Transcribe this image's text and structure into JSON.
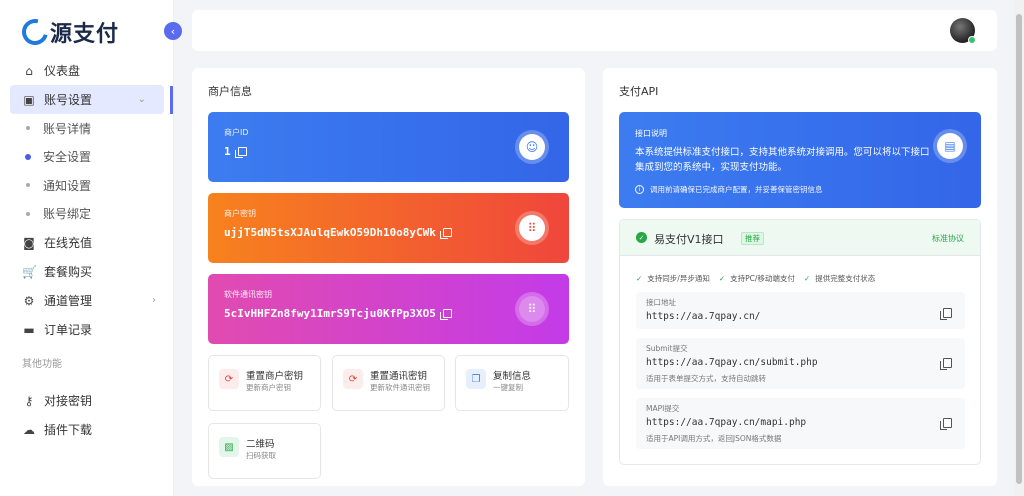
{
  "brand": {
    "name": "源支付"
  },
  "sidebar": {
    "items": [
      {
        "icon": "home-icon",
        "glyph": "⌂",
        "label": "仪表盘"
      },
      {
        "icon": "id-card-icon",
        "glyph": "▣",
        "label": "账号设置"
      },
      {
        "icon": "recharge-icon",
        "glyph": "◙",
        "label": "在线充值"
      },
      {
        "icon": "cart-icon",
        "glyph": "🛒",
        "label": "套餐购买"
      },
      {
        "icon": "gear-icon",
        "glyph": "⚙",
        "label": "通道管理"
      },
      {
        "icon": "wallet-icon",
        "glyph": "▬",
        "label": "订单记录"
      }
    ],
    "sub_items": [
      "账号详情",
      "安全设置",
      "通知设置",
      "账号绑定"
    ],
    "section_label": "其他功能",
    "other_items": [
      {
        "icon": "key-icon",
        "glyph": "⚷",
        "label": "对接密钥"
      },
      {
        "icon": "cloud-download-icon",
        "glyph": "☁",
        "label": "插件下载"
      }
    ]
  },
  "merchant": {
    "title": "商户信息",
    "cards": [
      {
        "label": "商户ID",
        "value": "1"
      },
      {
        "label": "商户密钥",
        "value": "ujjT5dN5tsXJAulqEwkO59Dh10o8yCWk"
      },
      {
        "label": "软件通讯密钥",
        "value": "5cIvHHFZn8fwy1ImrS9Tcju0KfPp3XO5"
      }
    ],
    "actions": [
      {
        "title": "重置商户密钥",
        "sub": "更新商户密钥"
      },
      {
        "title": "重置通讯密钥",
        "sub": "更新软件通讯密钥"
      },
      {
        "title": "复制信息",
        "sub": "一键复制"
      },
      {
        "title": "二维码",
        "sub": "扫码获取"
      }
    ]
  },
  "api": {
    "title": "支付API",
    "desc_title": "接口说明",
    "desc_body": "本系统提供标准支付接口，支持其他系统对接调用。您可以将以下接口集成到您的系统中，实现支付功能。",
    "desc_note": "调用前请确保已完成商户配置，并妥善保管密钥信息",
    "iface_name": "易支付V1接口",
    "iface_tag": "推荐",
    "iface_protocol": "标准协议",
    "features": [
      "支持同步/异步通知",
      "支持PC/移动端支付",
      "提供完整支付状态"
    ],
    "endpoints": [
      {
        "name": "接口地址",
        "url": "https://aa.7qpay.cn/",
        "desc": ""
      },
      {
        "name": "Submit提交",
        "url": "https://aa.7qpay.cn/submit.php",
        "desc": "适用于表单提交方式，支持自动跳转"
      },
      {
        "name": "MAPI提交",
        "url": "https://aa.7qpay.cn/mapi.php",
        "desc": "适用于API调用方式，返回JSON格式数据"
      }
    ]
  }
}
